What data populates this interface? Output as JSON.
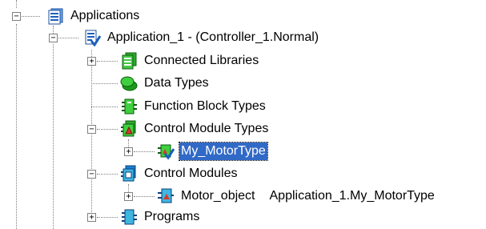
{
  "tree": {
    "items": [
      {
        "label": "Applications",
        "expander": "−"
      },
      {
        "label": "Application_1 - (Controller_1.Normal)",
        "expander": "−"
      },
      {
        "label": "Connected Libraries",
        "expander": "+"
      },
      {
        "label": "Data Types"
      },
      {
        "label": "Function Block Types"
      },
      {
        "label": "Control Module Types",
        "expander": "−"
      },
      {
        "label": "My_MotorType",
        "expander": "+"
      },
      {
        "label": "Control Modules",
        "expander": "−"
      },
      {
        "label": "Motor_object",
        "extra": "Application_1.My_MotorType",
        "expander": "+"
      },
      {
        "label": "Programs",
        "expander": "+"
      }
    ]
  },
  "icons": {
    "applications": "applications-folder-icon",
    "application": "application-check-icon",
    "libraries": "libraries-icon",
    "datatypes": "data-types-icon",
    "fbtypes": "function-block-types-icon",
    "cmtypes": "control-module-types-icon",
    "mytype": "motor-type-icon",
    "cms": "control-modules-icon",
    "motorobj": "control-module-object-icon",
    "programs": "programs-icon"
  },
  "colors": {
    "selection": "#3169c6",
    "green": "#1aa01a",
    "blue": "#1b5fbd",
    "cyan": "#3fb6e0"
  }
}
